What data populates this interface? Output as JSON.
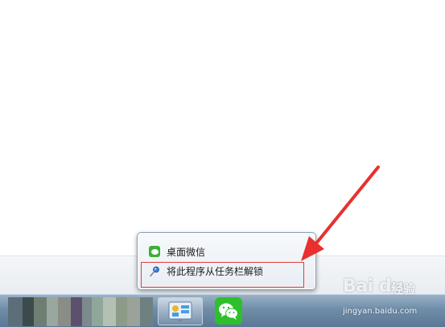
{
  "jump_list": {
    "items": [
      {
        "label": "桌面微信",
        "icon": "wechat-icon"
      },
      {
        "label": "将此程序从任务栏解锁",
        "icon": "pin-icon"
      }
    ]
  },
  "watermark": {
    "logo": "Bai du",
    "sub": "经验",
    "url": "jingyan.baidu.com"
  },
  "colors": {
    "highlight": "#e23a3a",
    "arrow": "#e8302e",
    "wechat": "#2ec02b",
    "taskbar": "#6f8ca8"
  }
}
